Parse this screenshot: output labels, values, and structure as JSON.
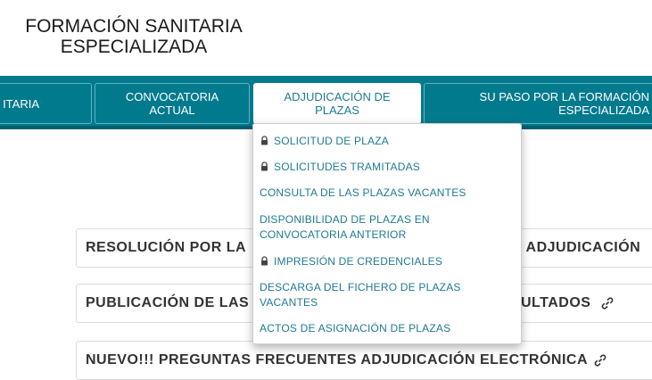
{
  "header": {
    "title_line1": "FORMACIÓN SANITARIA",
    "title_line2": "ESPECIALIZADA"
  },
  "nav": {
    "tabs": [
      {
        "label": "ITARIA"
      },
      {
        "label_line1": "CONVOCATORIA",
        "label_line2": "ACTUAL"
      },
      {
        "label_line1": "ADJUDICACIÓN DE",
        "label_line2": "PLAZAS"
      },
      {
        "label_line1": "SU PASO POR LA FORMACIÓN",
        "label_line2": "ESPECIALIZADA"
      }
    ]
  },
  "dropdown": {
    "items": [
      {
        "label": "SOLICITUD DE PLAZA",
        "locked": true
      },
      {
        "label": "SOLICITUDES TRAMITADAS",
        "locked": true
      },
      {
        "label": "CONSULTA DE LAS PLAZAS VACANTES",
        "locked": false
      },
      {
        "label_line1": "DISPONIBILIDAD DE PLAZAS EN",
        "label_line2": "CONVOCATORIA ANTERIOR",
        "locked": false
      },
      {
        "label": "IMPRESIÓN DE CREDENCIALES",
        "locked": true
      },
      {
        "label_line1": "DESCARGA DEL FICHERO DE PLAZAS",
        "label_line2": "VACANTES",
        "locked": false
      },
      {
        "label": "ACTOS DE ASIGNACIÓN DE PLAZAS",
        "locked": false
      }
    ]
  },
  "cards": [
    {
      "left_text": "RESOLUCIÓN POR LA",
      "right_text": "E ADJUDICACIÓN"
    },
    {
      "left_text": "PUBLICACIÓN DE LAS",
      "right_text": "ULTADOS"
    },
    {
      "text": "NUEVO!!! PREGUNTAS FRECUENTES ADJUDICACIÓN ELECTRÓNICA"
    }
  ],
  "colors": {
    "nav_bg": "#027a8e",
    "link": "#1f7a92",
    "text": "#333333"
  }
}
